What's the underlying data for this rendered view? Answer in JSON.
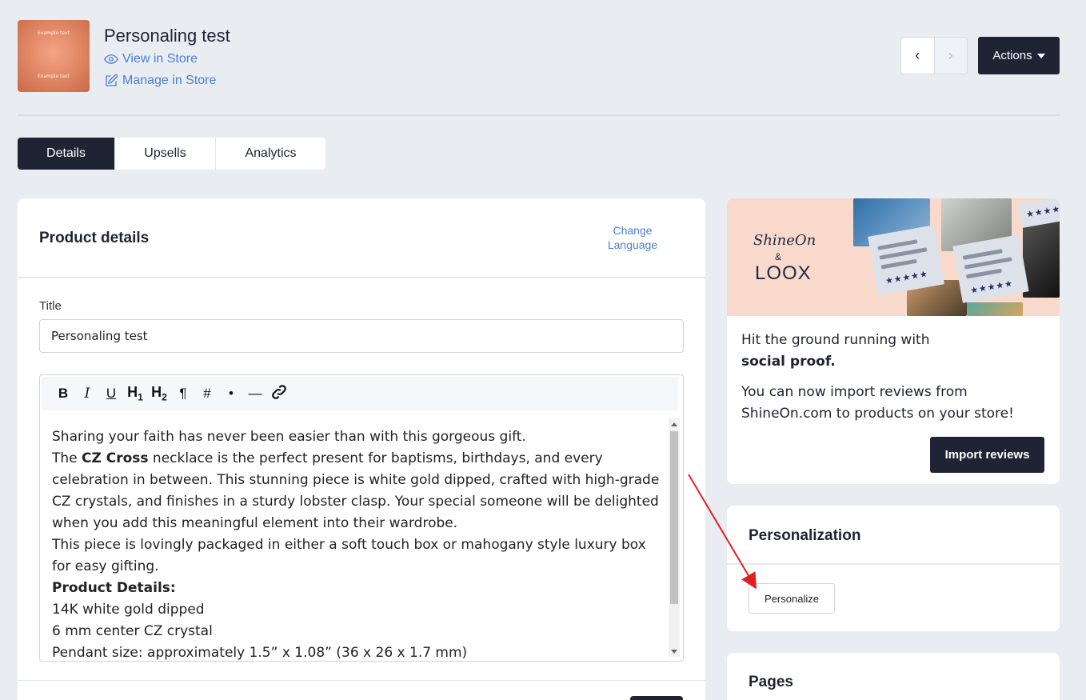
{
  "header": {
    "product_title": "Personaling test",
    "thumbnail_text_top": "Example text",
    "thumbnail_text_bottom": "Example text",
    "view_in_store": "View in Store",
    "manage_in_store": "Manage in Store",
    "actions_label": "Actions"
  },
  "tabs": [
    {
      "label": "Details",
      "active": true
    },
    {
      "label": "Upsells",
      "active": false
    },
    {
      "label": "Analytics",
      "active": false
    }
  ],
  "product_details": {
    "heading": "Product details",
    "change_language_line1": "Change",
    "change_language_line2": "Language",
    "title_label": "Title",
    "title_value": "Personaling test",
    "toolbar": [
      "B",
      "I",
      "U",
      "H1",
      "H2",
      "¶",
      "#",
      "•",
      "—",
      "link"
    ],
    "description": {
      "line1": "Sharing your faith has never been easier than with this gorgeous gift.",
      "line2_pre": "The ",
      "line2_bold": "CZ Cross",
      "line2_post": " necklace is the perfect present for baptisms, birthdays, and every celebration in between. This stunning piece is white gold dipped, crafted with high-grade CZ crystals, and finishes in a sturdy lobster clasp. Your special someone will be delighted when you add this meaningful element into their wardrobe.",
      "line3": "This piece is lovingly packaged in either a soft touch box or mahogany style luxury box for easy gifting.",
      "details_heading": "Product Details:",
      "detail1": "14K white gold dipped",
      "detail2": "6 mm center CZ crystal",
      "detail3": "Pendant size: approximately 1.5” x 1.08” (36 x 26 x 1.7 mm)"
    }
  },
  "promo": {
    "logo_shineon": "ShineOn",
    "logo_amp": "&",
    "logo_loox": "LOOX",
    "line1": "Hit the ground running with",
    "line1_bold": "social proof.",
    "line2": "You can now import reviews from ShineOn.com to products on your store!",
    "button": "Import reviews",
    "stars": "★★★★★"
  },
  "personalization": {
    "heading": "Personalization",
    "button": "Personalize"
  },
  "pages": {
    "heading": "Pages"
  },
  "colors": {
    "dark": "#1f2333",
    "link": "#4a7fd6",
    "background": "#e9edf2",
    "annotation_arrow": "#e02020"
  }
}
